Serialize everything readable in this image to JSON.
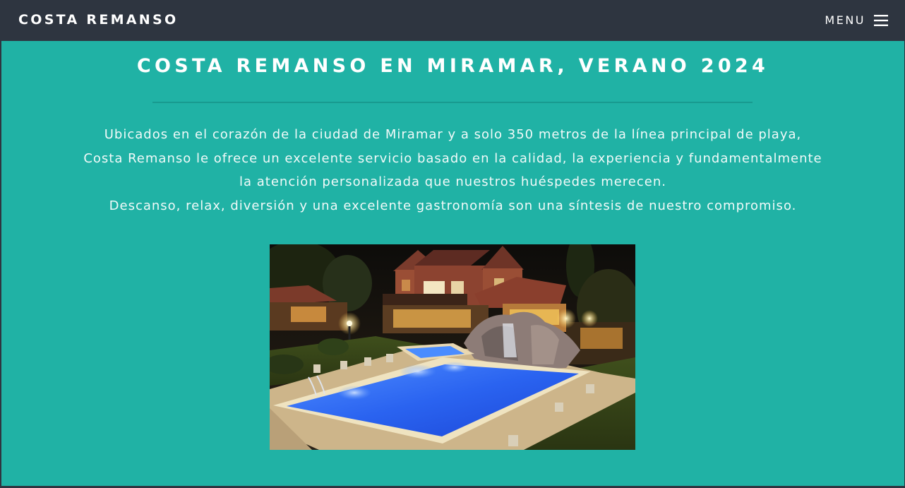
{
  "navbar": {
    "brand": "COSTA REMANSO",
    "menu_label": "MENU",
    "menu_icon": "hamburger-icon"
  },
  "main": {
    "title": "COSTA REMANSO EN MIRAMAR, VERANO 2024",
    "description": [
      "Ubicados en el corazón de la ciudad de Miramar y a solo 350 metros de la línea principal de playa,",
      "Costa Remanso le ofrece un excelente servicio basado en la calidad, la experiencia y fundamentalmente",
      "la atención personalizada que nuestros huéspedes merecen.",
      "Descanso, relax, diversión y una excelente gastronomía son una síntesis de nuestro compromiso."
    ]
  },
  "colors": {
    "navbar_bg": "#2e3540",
    "section_bg": "#20b2a5",
    "divider": "#189a8f",
    "text": "#ffffff"
  }
}
